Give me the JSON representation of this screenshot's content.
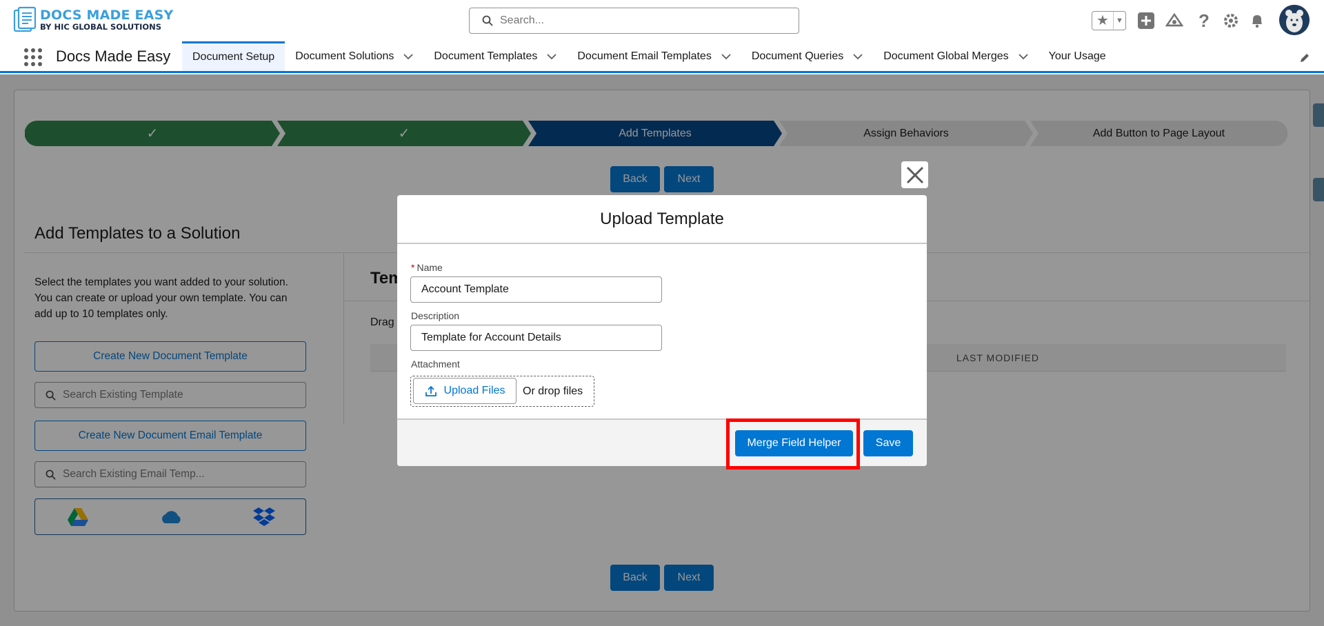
{
  "logo": {
    "title": "DOCS MADE EASY",
    "subtitle": "BY HIC GLOBAL SOLUTIONS"
  },
  "global_search": {
    "placeholder": "Search..."
  },
  "header_icons": [
    "star-icon",
    "chevron-down-icon",
    "plus-icon",
    "trailhead-icon",
    "help-icon",
    "gear-icon",
    "bell-icon",
    "avatar"
  ],
  "app": {
    "name": "Docs Made Easy",
    "nav": [
      {
        "label": "Document Setup",
        "active": true,
        "has_menu": false
      },
      {
        "label": "Document Solutions",
        "active": false,
        "has_menu": true
      },
      {
        "label": "Document Templates",
        "active": false,
        "has_menu": true
      },
      {
        "label": "Document Email Templates",
        "active": false,
        "has_menu": true
      },
      {
        "label": "Document Queries",
        "active": false,
        "has_menu": true
      },
      {
        "label": "Document Global Merges",
        "active": false,
        "has_menu": true
      },
      {
        "label": "Your Usage",
        "active": false,
        "has_menu": false
      }
    ]
  },
  "progress": {
    "steps": [
      {
        "label": "",
        "status": "complete"
      },
      {
        "label": "",
        "status": "complete"
      },
      {
        "label": "Add Templates",
        "status": "current"
      },
      {
        "label": "Assign Behaviors",
        "status": "upcoming"
      },
      {
        "label": "Add Button to Page Layout",
        "status": "upcoming"
      }
    ]
  },
  "nav_buttons": {
    "back": "Back",
    "next": "Next"
  },
  "section": {
    "title": "Add Templates to a Solution",
    "description": "Select the templates you want added to your solution. You can create or upload your own template. You can add up to 10 templates only.",
    "create_template": "Create New Document Template",
    "search_template_placeholder": "Search Existing Template",
    "create_email_template": "Create New Document Email Template",
    "search_email_placeholder": "Search Existing Email Temp...",
    "clouds": [
      "google-drive-icon",
      "onedrive-icon",
      "dropbox-icon"
    ],
    "templates_heading": "Tem",
    "drag_text": "Drag",
    "table_last_modified": "LAST MODIFIED"
  },
  "modal": {
    "title": "Upload Template",
    "name_label": "Name",
    "name_required_mark": "*",
    "name_value": "Account Template",
    "description_label": "Description",
    "description_value": "Template for Account Details",
    "attachment_label": "Attachment",
    "upload_label": "Upload Files",
    "drop_label": "Or drop files",
    "merge_helper": "Merge Field Helper",
    "save": "Save"
  },
  "colors": {
    "brand_blue": "#0176d3",
    "complete_green": "#2e844a",
    "current_navy": "#014486",
    "highlight_red": "#ff0000"
  }
}
